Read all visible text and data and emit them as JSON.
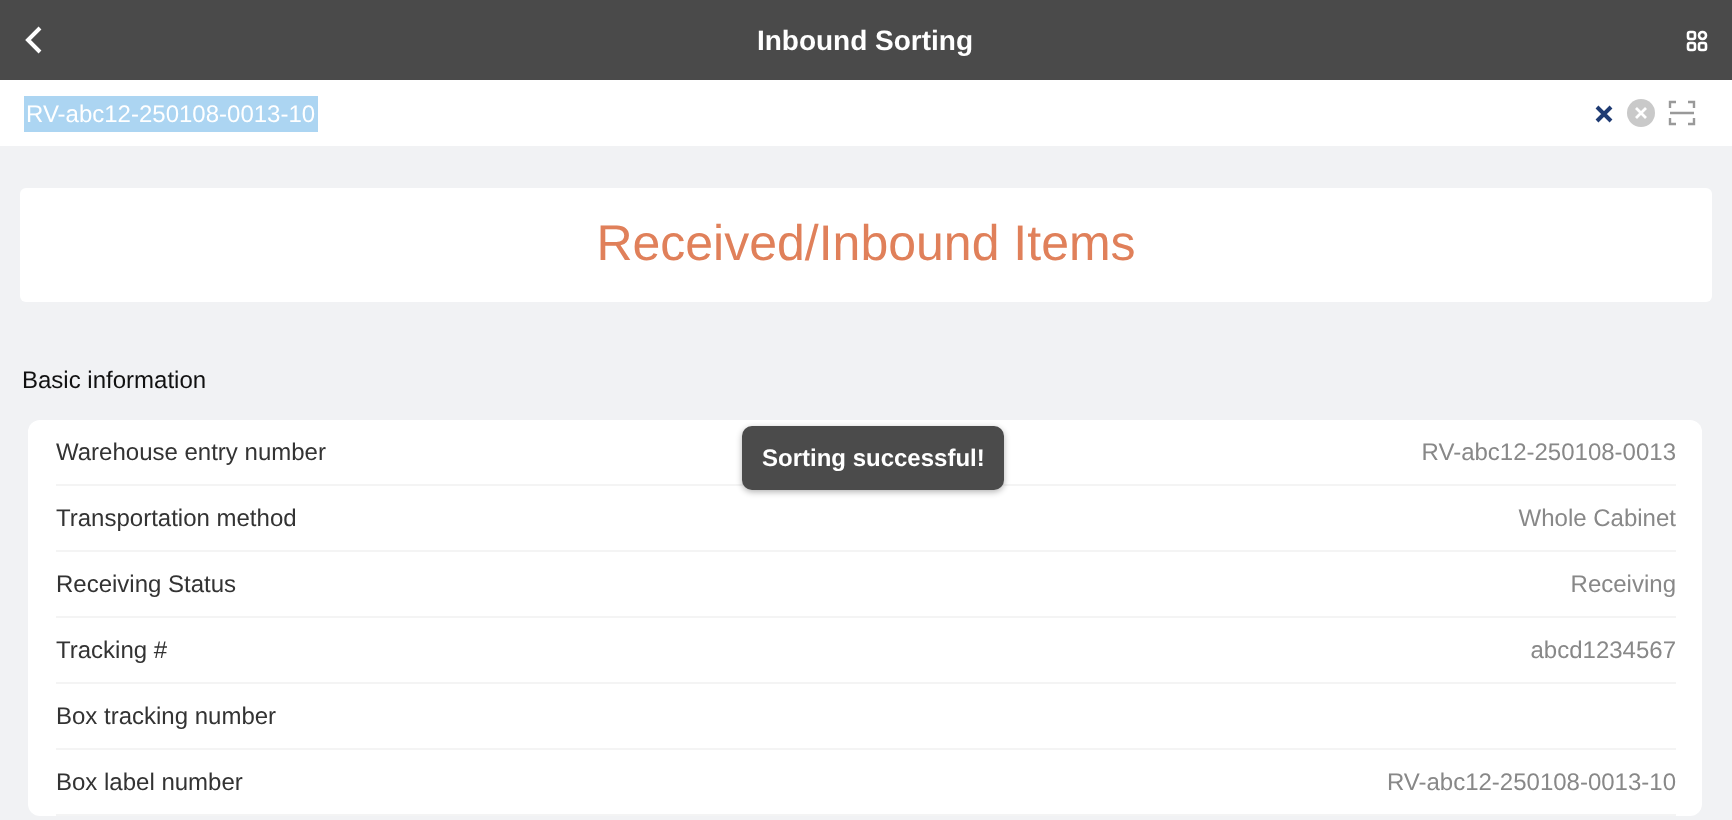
{
  "header": {
    "title": "Inbound Sorting"
  },
  "search": {
    "value": "RV-abc12-250108-0013-10",
    "text_selected": true
  },
  "banner": {
    "title": "Received/Inbound Items"
  },
  "section": {
    "title": "Basic information"
  },
  "fields": [
    {
      "label": "Warehouse entry number",
      "value": "RV-abc12-250108-0013"
    },
    {
      "label": "Transportation method",
      "value": "Whole Cabinet"
    },
    {
      "label": "Receiving Status",
      "value": "Receiving"
    },
    {
      "label": "Tracking #",
      "value": "abcd1234567"
    },
    {
      "label": "Box tracking number"
    },
    {
      "label": "Box label number",
      "value": "RV-abc12-250108-0013-10"
    }
  ],
  "toast": {
    "text": "Sorting successful!"
  }
}
